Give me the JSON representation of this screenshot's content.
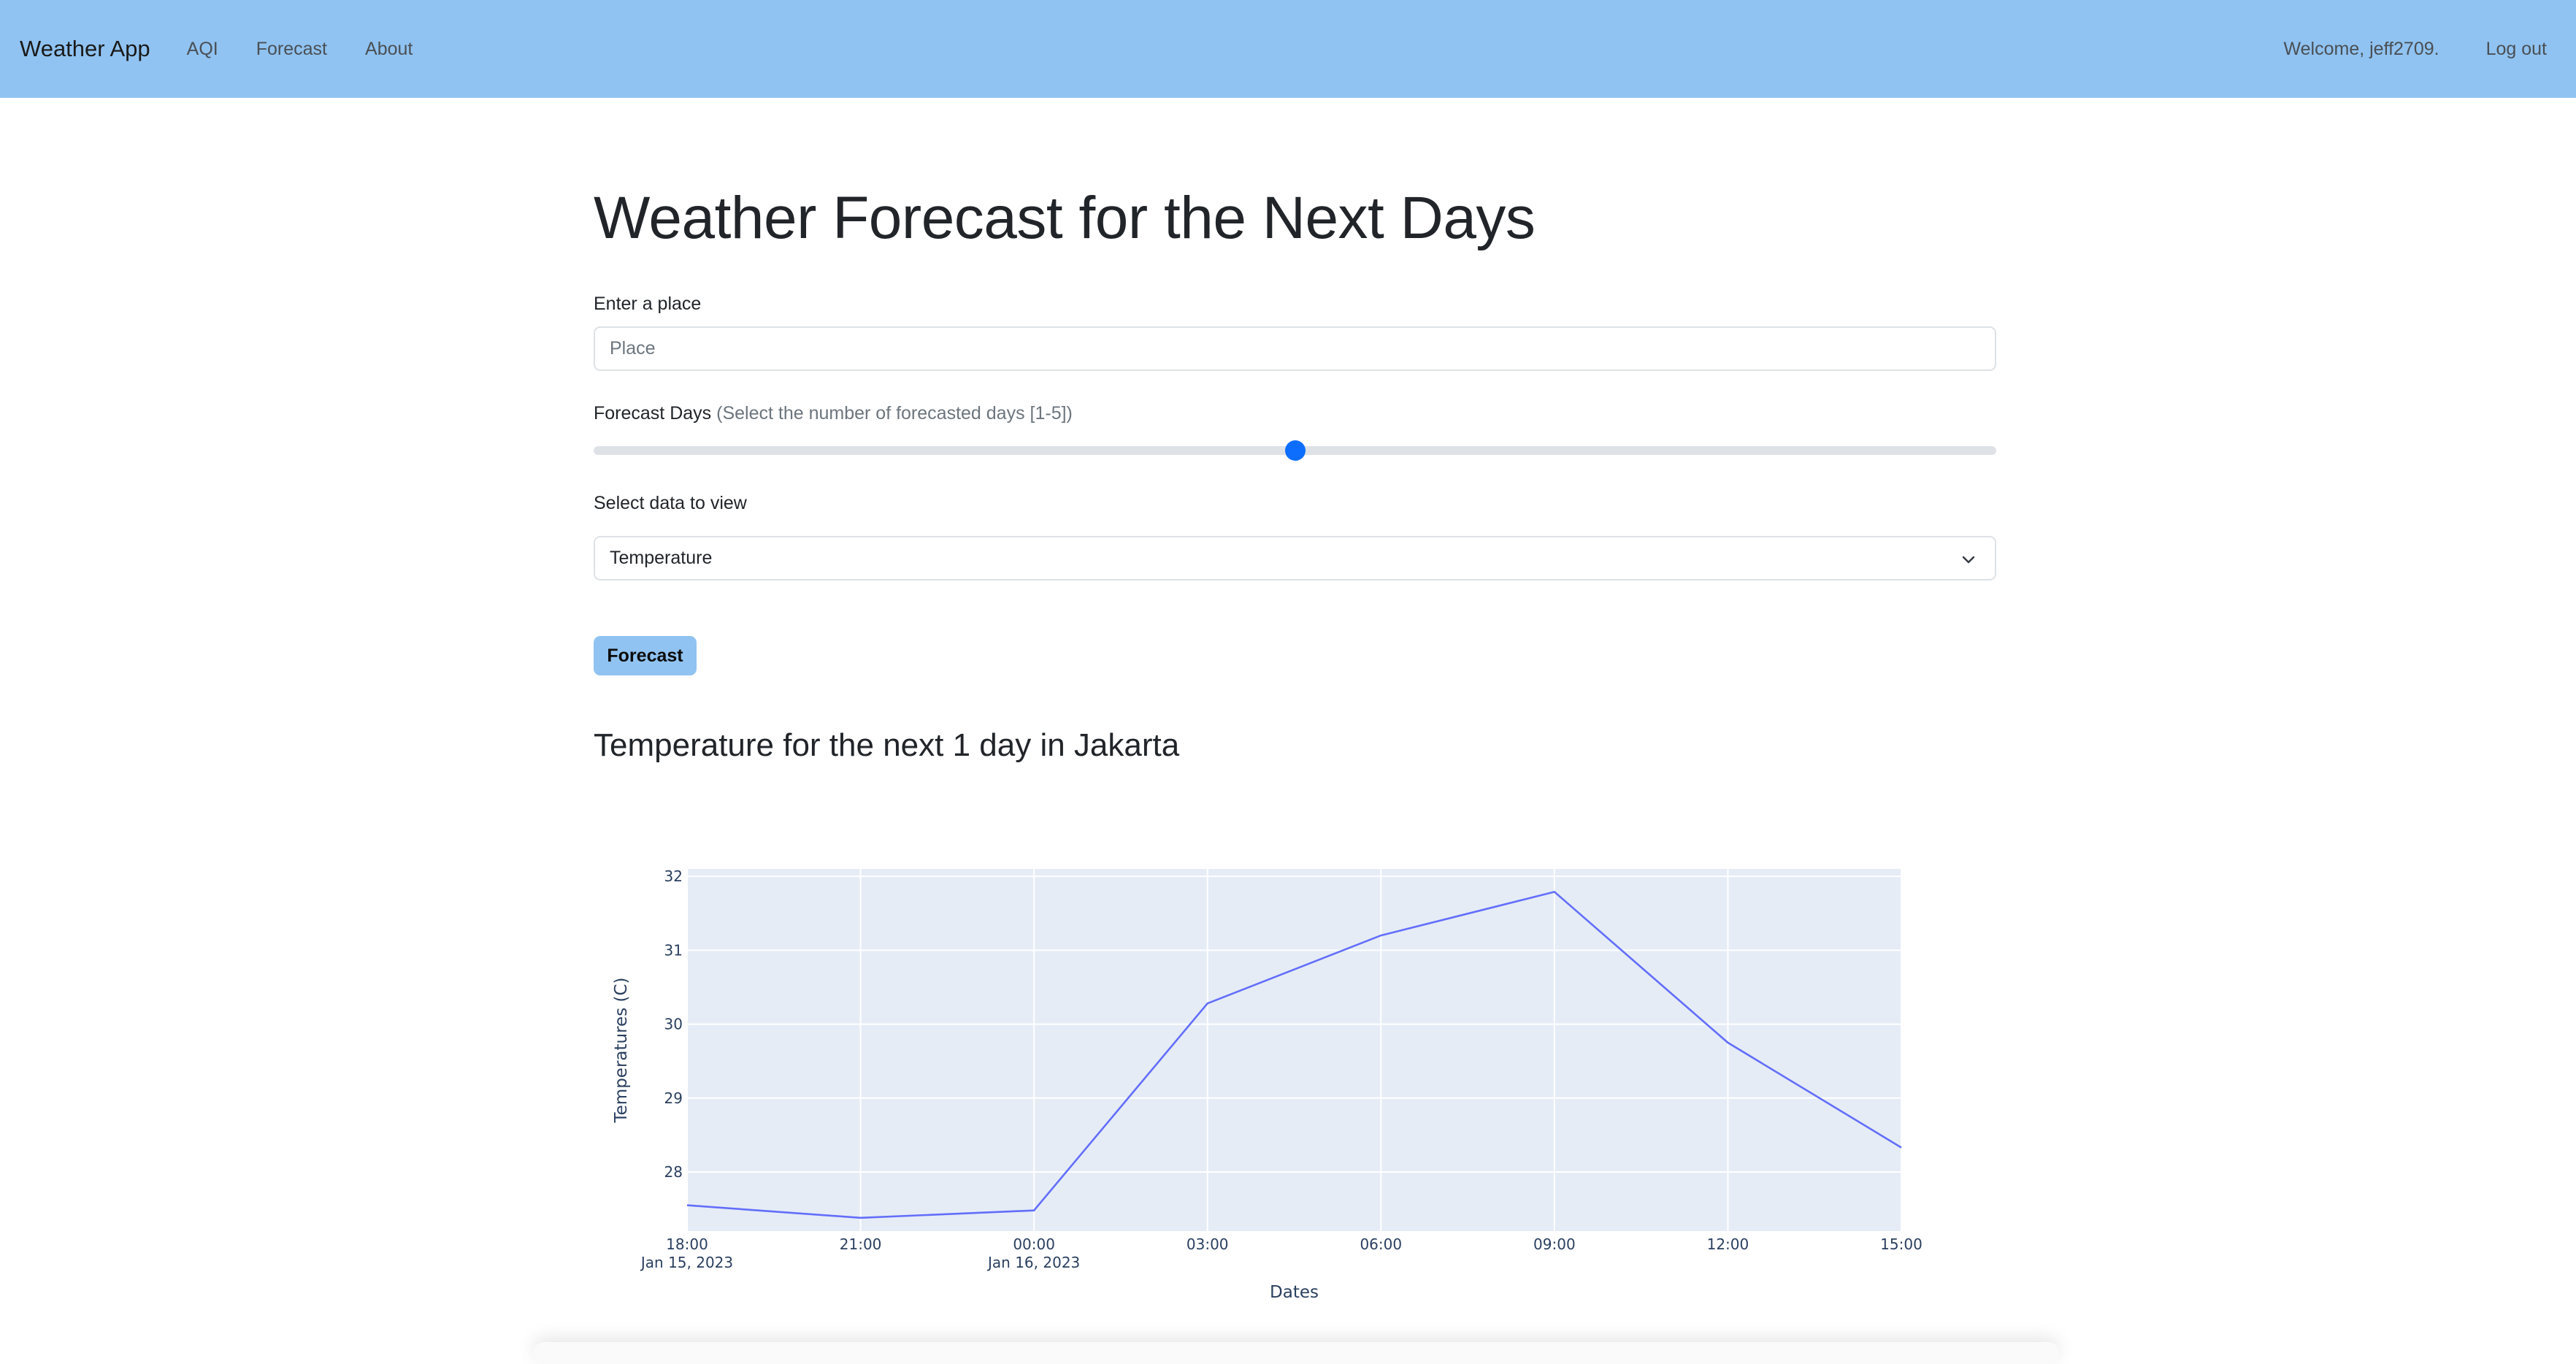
{
  "navbar": {
    "brand": "Weather App",
    "links": [
      "AQI",
      "Forecast",
      "About"
    ],
    "welcome": "Welcome, jeff2709.",
    "logout": "Log out"
  },
  "main": {
    "title": "Weather Forecast for the Next Days",
    "place_label": "Enter a place",
    "place_placeholder": "Place",
    "place_value": "",
    "days_label": "Forecast Days",
    "days_hint": "(Select the number of forecasted days [1-5])",
    "days_slider_fraction": 0.5,
    "select_label": "Select data to view",
    "select_value": "Temperature",
    "button_label": "Forecast",
    "chart_heading": "Temperature for the next 1 day in Jakarta"
  },
  "icons": {
    "select_arrow": "chevron-down-icon"
  },
  "colors": {
    "navbar_bg": "#90c3f1",
    "button_bg": "#90c3f1",
    "slider_thumb": "#0d6efd",
    "plot_bg": "#e5ecf6",
    "line": "#636efa"
  },
  "chart_data": {
    "type": "line",
    "xlabel": "Dates",
    "ylabel": "Temperatures (C)",
    "x": [
      "Jan 15, 2023 18:00",
      "Jan 15, 2023 21:00",
      "Jan 16, 2023 00:00",
      "Jan 16, 2023 03:00",
      "Jan 16, 2023 06:00",
      "Jan 16, 2023 09:00",
      "Jan 16, 2023 12:00",
      "Jan 16, 2023 15:00"
    ],
    "y": [
      27.55,
      27.38,
      27.48,
      30.28,
      31.2,
      31.79,
      29.75,
      28.33
    ],
    "x_ticks": [
      {
        "l1": "18:00",
        "l2": "Jan 15, 2023"
      },
      {
        "l1": "21:00",
        "l2": ""
      },
      {
        "l1": "00:00",
        "l2": "Jan 16, 2023"
      },
      {
        "l1": "03:00",
        "l2": ""
      },
      {
        "l1": "06:00",
        "l2": ""
      },
      {
        "l1": "09:00",
        "l2": ""
      },
      {
        "l1": "12:00",
        "l2": ""
      },
      {
        "l1": "15:00",
        "l2": ""
      }
    ],
    "y_ticks": [
      28,
      29,
      30,
      31,
      32
    ],
    "ylim": [
      27.2,
      32.1
    ],
    "grid": true,
    "legend": "none"
  }
}
